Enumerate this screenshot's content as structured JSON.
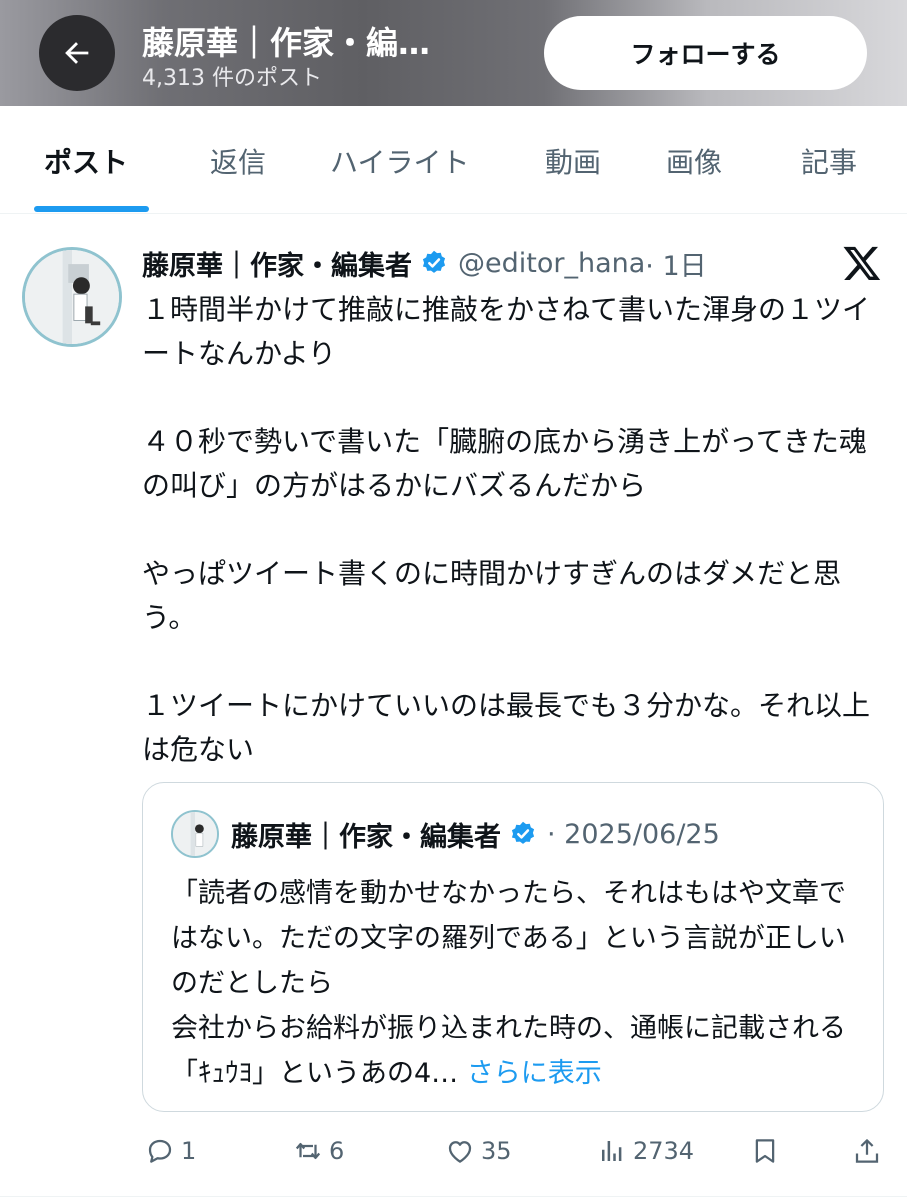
{
  "header": {
    "title": "藤原華｜作家・編…",
    "post_count": "4,313 件のポスト",
    "follow_label": "フォローする"
  },
  "tabs": [
    {
      "label": "ポスト",
      "active": true
    },
    {
      "label": "返信"
    },
    {
      "label": "ハイライト"
    },
    {
      "label": "動画"
    },
    {
      "label": "画像"
    },
    {
      "label": "記事"
    }
  ],
  "post": {
    "author_name": "藤原華｜作家・編集者",
    "handle": "@editor_hana",
    "time": "· 1日",
    "paragraphs": [
      "１時間半かけて推敲に推敲をかさねて書いた渾身の１ツイートなんかより",
      "４０秒で勢いで書いた「臓腑の底から湧き上がってきた魂の叫び」の方がはるかにバズるんだから",
      "やっぱツイート書くのに時間かけすぎんのはダメだと思う。",
      "１ツイートにかけていいのは最長でも３分かな。それ以上は危ない"
    ],
    "quote": {
      "author_name": "藤原華｜作家・編集者",
      "date": "· 2025/06/25",
      "lines": [
        "「読者の感情を動かせなかったら、それはもはや文章ではない。ただの文字の羅列である」という言説が正しいのだとしたら",
        "会社からお給料が振り込まれた時の、通帳に記載される「ｷｭｳﾖ」というあの4… "
      ],
      "show_more": "さらに表示"
    },
    "stats": {
      "replies": "1",
      "reposts": "6",
      "likes": "35",
      "views": "2734"
    }
  },
  "colors": {
    "accent": "#1d9bf0",
    "text": "#0f1419",
    "muted": "#536471"
  }
}
